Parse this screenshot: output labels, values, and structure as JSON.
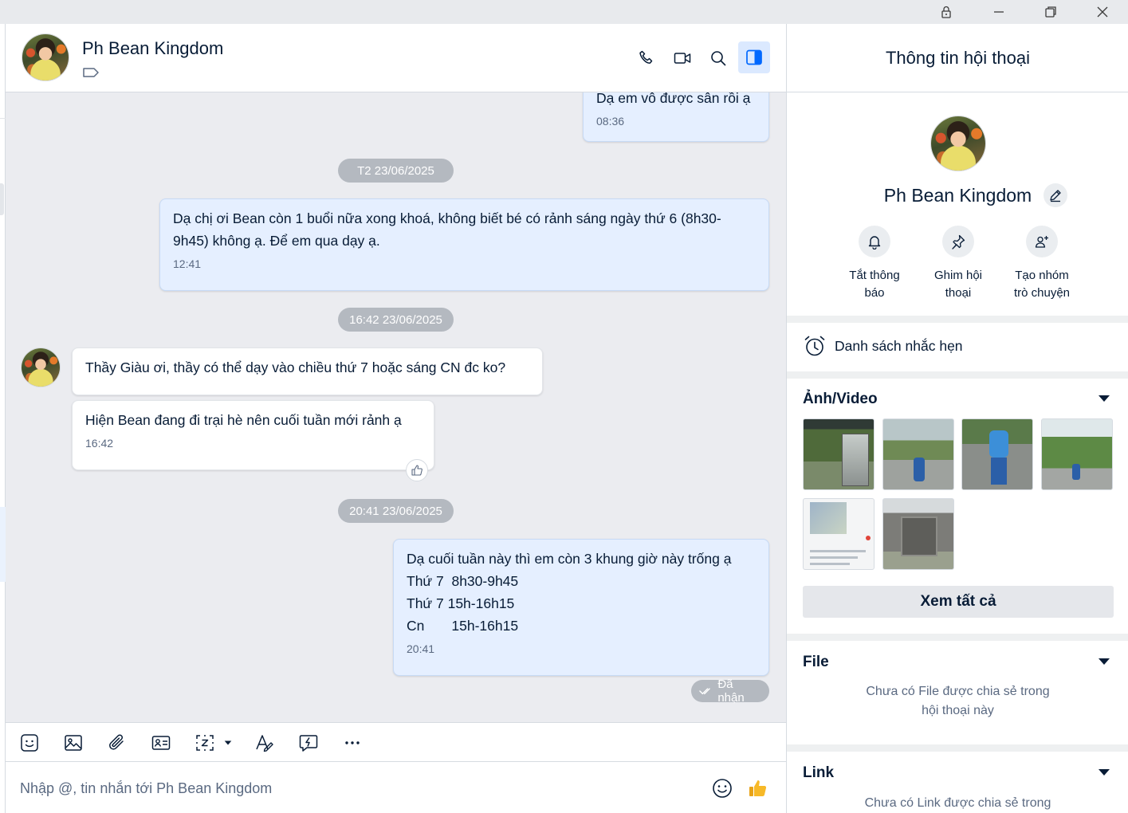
{
  "window": {
    "controls": [
      "lock-icon",
      "minimize-icon",
      "restore-icon",
      "close-icon"
    ]
  },
  "header": {
    "name": "Ph Bean Kingdom",
    "icons": [
      "phone-icon",
      "video-call-icon",
      "search-icon",
      "toggle-panel-icon"
    ]
  },
  "messages": {
    "items": [
      {
        "side": "me",
        "text": "Dạ em vô được sân rồi ạ",
        "time": "08:36"
      },
      {
        "kind": "date",
        "text": "T2 23/06/2025"
      },
      {
        "side": "me",
        "text": "Dạ chị ơi Bean còn 1 buổi nữa xong khoá, không biết bé có rảnh sáng ngày thứ 6 (8h30-\n9h45) không ạ. Để em qua dạy ạ.",
        "time": "12:41"
      },
      {
        "kind": "date",
        "text": "16:42 23/06/2025"
      },
      {
        "side": "them",
        "text": "Thầy Giàu ơi, thầy có thể dạy vào chiều thứ 7 hoặc sáng CN đc ko?"
      },
      {
        "side": "them",
        "text": "Hiện Bean đang đi trại hè nên cuối tuần mới rảnh ạ",
        "time": "16:42"
      },
      {
        "kind": "date",
        "text": "20:41 23/06/2025"
      },
      {
        "side": "me",
        "text": "Dạ cuối tuần này thì em còn 3 khung giờ này trống ạ\nThứ 7  8h30-9h45\nThứ 7 15h-16h15\nCn       15h-16h15",
        "time": "20:41"
      }
    ],
    "status": "Đã nhận"
  },
  "toolbar": {
    "icons": [
      "sticker-icon",
      "image-icon",
      "attachment-icon",
      "contact-card-icon",
      "screenshot-icon",
      "dropdown-caret-icon",
      "text-format-icon",
      "quick-message-icon",
      "more-icon"
    ]
  },
  "composer": {
    "placeholder": "Nhập @, tin nhắn tới Ph Bean Kingdom",
    "value": ""
  },
  "panel": {
    "title": "Thông tin hội thoại",
    "profile_name": "Ph Bean Kingdom",
    "actions": [
      {
        "label": "Tắt thông\nbáo",
        "icon": "bell-icon"
      },
      {
        "label": "Ghim hội\nthoại",
        "icon": "pin-icon"
      },
      {
        "label": "Tạo nhóm\ntrò chuyện",
        "icon": "add-group-icon"
      }
    ],
    "reminder_label": "Danh sách nhắc hẹn",
    "media_title": "Ảnh/Video",
    "view_all": "Xem tất cả",
    "thumb_count": 6,
    "file_title": "File",
    "file_empty": "Chưa có File được chia sẻ trong\nhội thoại này",
    "link_title": "Link",
    "link_empty": "Chưa có Link được chia sẻ trong"
  },
  "colors": {
    "accent": "#0068ff",
    "my_bubble": "#e5efff",
    "chat_bg": "#ebecf0"
  }
}
